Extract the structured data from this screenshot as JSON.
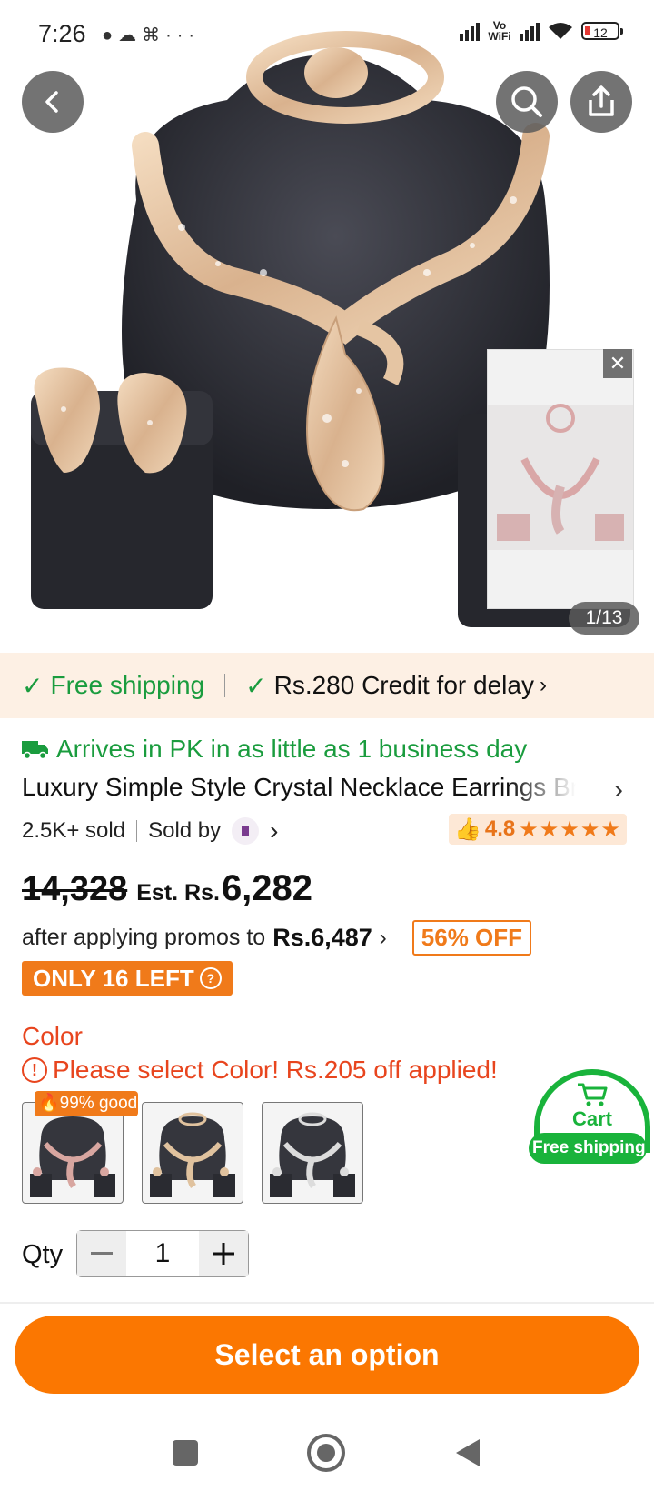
{
  "status_bar": {
    "time": "7:26",
    "left_icons": [
      "chat-icon",
      "cloud-icon",
      "gamepad-icon",
      "more-icon"
    ],
    "network_label": "Vo WiFi",
    "battery": "12"
  },
  "hero": {
    "image_counter": "1/13",
    "buttons": [
      "back-icon",
      "search-icon",
      "share-icon"
    ]
  },
  "shipping_banner": {
    "free_shipping": "Free shipping",
    "credit_delay": "Rs.280 Credit for delay"
  },
  "product": {
    "arrival": "Arrives in PK in as little as 1 business day",
    "title": "Luxury Simple Style Crystal Necklace Earrings Bracelet Ring Jewelry Set",
    "sold_count": "2.5K+ sold",
    "sold_by": "Sold by",
    "rating": "4.8",
    "stars": "★★★★★"
  },
  "pricing": {
    "original_price": "14,328",
    "est_label": "Est. Rs.",
    "sale_price": "6,282",
    "promo_text": "after applying promos to",
    "promo_amount": "Rs.6,487",
    "discount": "56% OFF",
    "stock": "ONLY 16 LEFT"
  },
  "color": {
    "label": "Color",
    "warning": "Please select Color! Rs.205 off applied!",
    "top_badge": "99% good",
    "options": [
      "rose-gold-set",
      "gold-set",
      "silver-set"
    ]
  },
  "cart_float": {
    "label": "Cart",
    "badge": "Free shipping"
  },
  "quantity": {
    "label": "Qty",
    "value": "1"
  },
  "cta": {
    "label": "Select an option"
  },
  "colors": {
    "accent": "#fb7701",
    "green": "#1a9c3e",
    "warning": "#e8451e"
  }
}
